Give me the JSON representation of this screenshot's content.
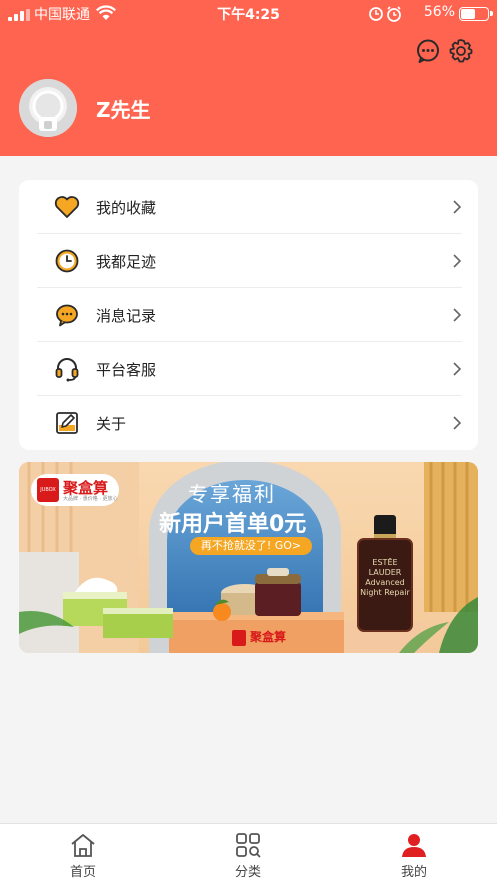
{
  "status_bar": {
    "carrier": "中国联通",
    "time": "下午4:25",
    "battery_percent": "56%",
    "battery_level": 0.56
  },
  "header": {
    "username": "Z先生",
    "actions": [
      "message-icon",
      "settings-icon"
    ]
  },
  "menu": {
    "items": [
      {
        "label": "我的收藏",
        "icon": "heart-icon"
      },
      {
        "label": "我都足迹",
        "icon": "clock-icon"
      },
      {
        "label": "消息记录",
        "icon": "chat-bubble-icon"
      },
      {
        "label": "平台客服",
        "icon": "headset-icon"
      },
      {
        "label": "关于",
        "icon": "edit-note-icon"
      }
    ]
  },
  "banner": {
    "brand_name": "聚盒算",
    "brand_logo_text": "JUBOX",
    "brand_tagline": "大品牌 · 惠价格 · 更放心",
    "headline_sub": "专享福利",
    "headline_main": "新用户首单0元",
    "cta": "再不抢就没了! GO>",
    "bottle_label": "ESTĒE LAUDER\nAdvanced\nNight Repair",
    "footer_brand": "聚盒算"
  },
  "tabbar": {
    "tabs": [
      {
        "label": "首页",
        "icon": "home-icon",
        "active": false
      },
      {
        "label": "分类",
        "icon": "category-grid-icon",
        "active": false
      },
      {
        "label": "我的",
        "icon": "user-icon",
        "active": true
      }
    ]
  },
  "colors": {
    "brand": "#ff6450",
    "icon_accent": "#f5a623",
    "banner_red": "#d91a1a"
  }
}
